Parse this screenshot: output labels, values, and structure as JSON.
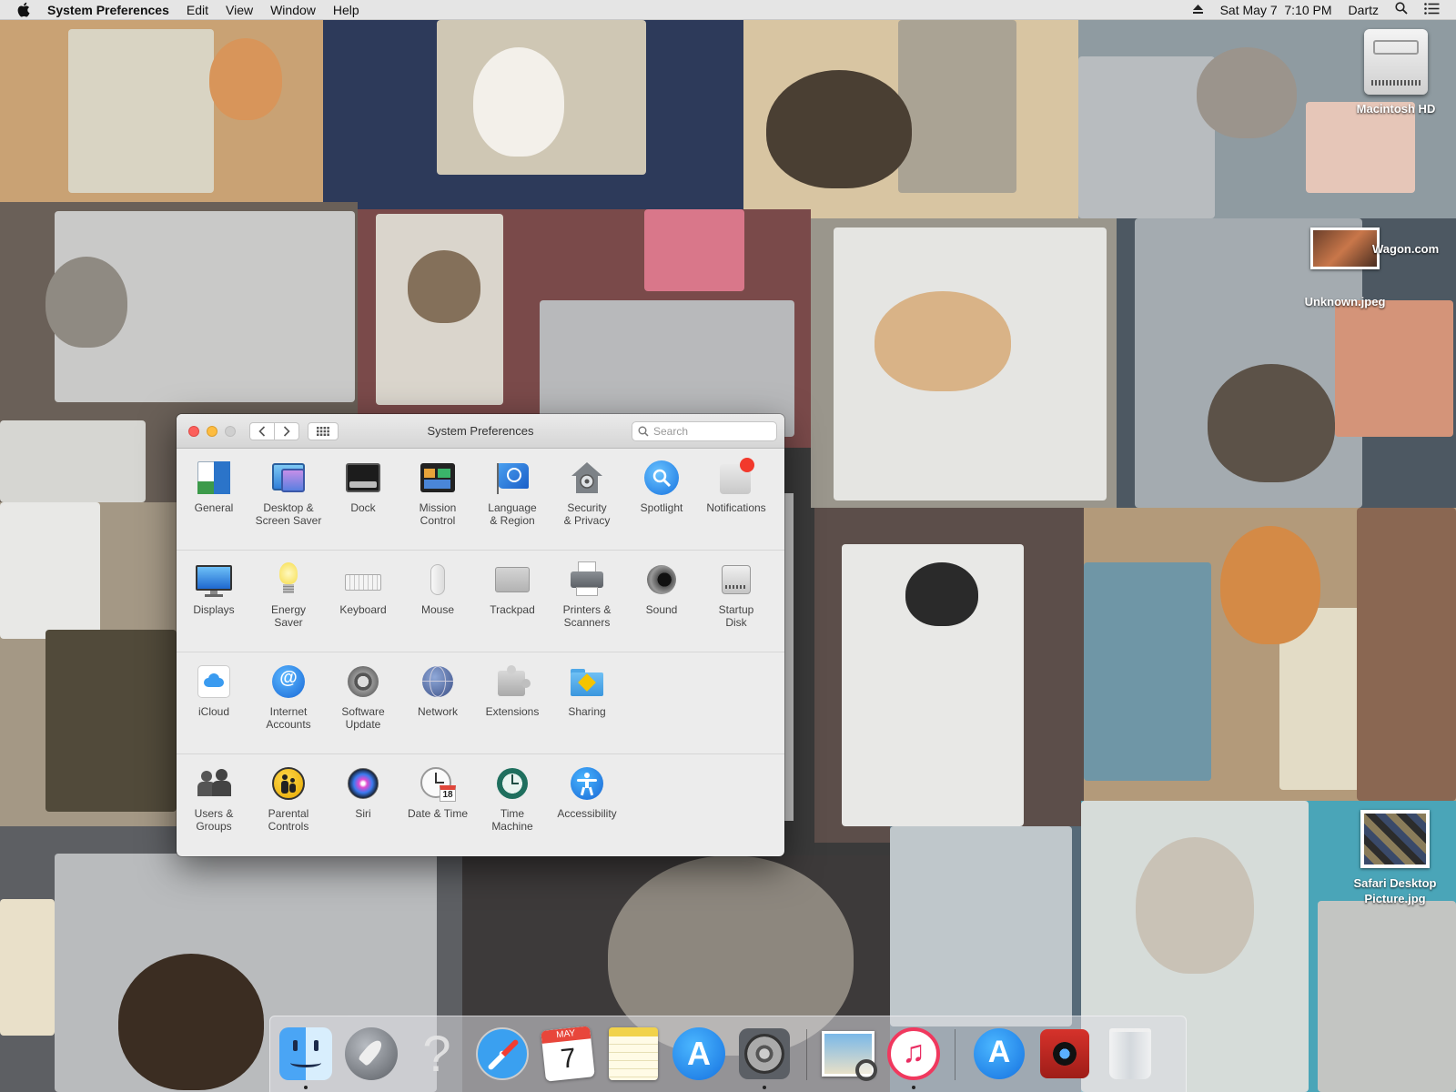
{
  "menubar": {
    "app_name": "System Preferences",
    "items": [
      "Edit",
      "View",
      "Window",
      "Help"
    ],
    "clock": "Sat May 7  7:10 PM",
    "user": "Dartz"
  },
  "desktop_icons": {
    "hd": "Macintosh HD",
    "wagon": "Wagon.com",
    "unknown": "Unknown.jpeg",
    "safari_pic": "Safari Desktop Picture.jpg"
  },
  "window": {
    "title": "System Preferences",
    "search_placeholder": "Search"
  },
  "panes": {
    "row1": [
      "General",
      "Desktop &\nScreen Saver",
      "Dock",
      "Mission\nControl",
      "Language\n& Region",
      "Security\n& Privacy",
      "Spotlight",
      "Notifications"
    ],
    "row2": [
      "Displays",
      "Energy\nSaver",
      "Keyboard",
      "Mouse",
      "Trackpad",
      "Printers &\nScanners",
      "Sound",
      "Startup\nDisk"
    ],
    "row3": [
      "iCloud",
      "Internet\nAccounts",
      "Software\nUpdate",
      "Network",
      "Extensions",
      "Sharing"
    ],
    "row4": [
      "Users &\nGroups",
      "Parental\nControls",
      "Siri",
      "Date & Time",
      "Time\nMachine",
      "Accessibility"
    ]
  },
  "calendar_icon": {
    "month": "MAY",
    "day": "7"
  },
  "date_pane_icon": {
    "day": "18"
  },
  "colors": {
    "accent_blue": "#1e7cf2",
    "notification_red": "#f2392c",
    "traffic_red": "#fc605c",
    "traffic_yellow": "#fdbc40"
  }
}
